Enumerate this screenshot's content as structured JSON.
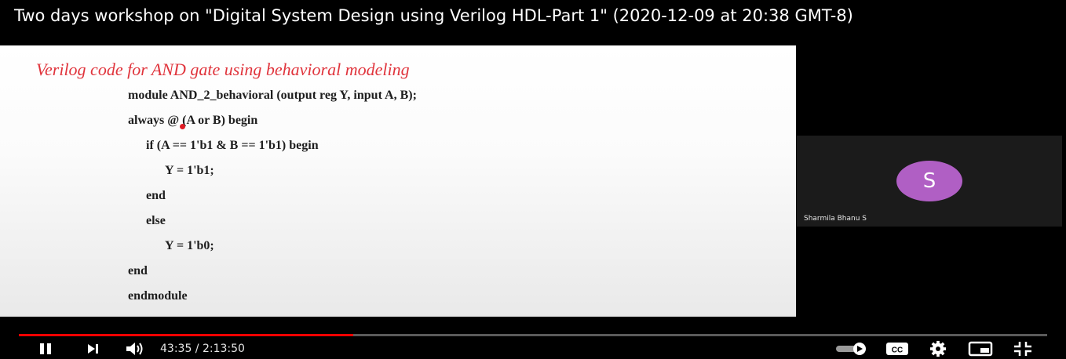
{
  "video": {
    "title": "Two days workshop on \"Digital System Design using Verilog HDL-Part 1\" (2020-12-09 at 20:38 GMT-8)"
  },
  "slide": {
    "heading": "Verilog code for AND gate using behavioral modeling",
    "code_lines": [
      "module AND_2_behavioral (output reg Y, input A, B);",
      "always @ (A or B) begin",
      "if (A == 1'b1 & B == 1'b1) begin",
      "Y = 1'b1;",
      "end",
      "else",
      "Y = 1'b0;",
      "end",
      "endmodule"
    ]
  },
  "participant": {
    "avatar_letter": "S",
    "avatar_color": "#b05fc4",
    "name": "Sharmila Bhanu S"
  },
  "player": {
    "current_time": "43:35",
    "duration": "2:13:50",
    "time_display": "43:35 / 2:13:50",
    "progress_fraction": 0.325,
    "accent_color": "#ff0000",
    "controls": {
      "play_pause": "pause-icon",
      "next": "next-icon",
      "volume": "volume-icon",
      "autoplay": "autoplay-toggle-icon",
      "captions": "CC",
      "settings": "gear-icon",
      "miniplayer": "miniplayer-icon",
      "fullscreen": "exit-fullscreen-icon"
    }
  }
}
